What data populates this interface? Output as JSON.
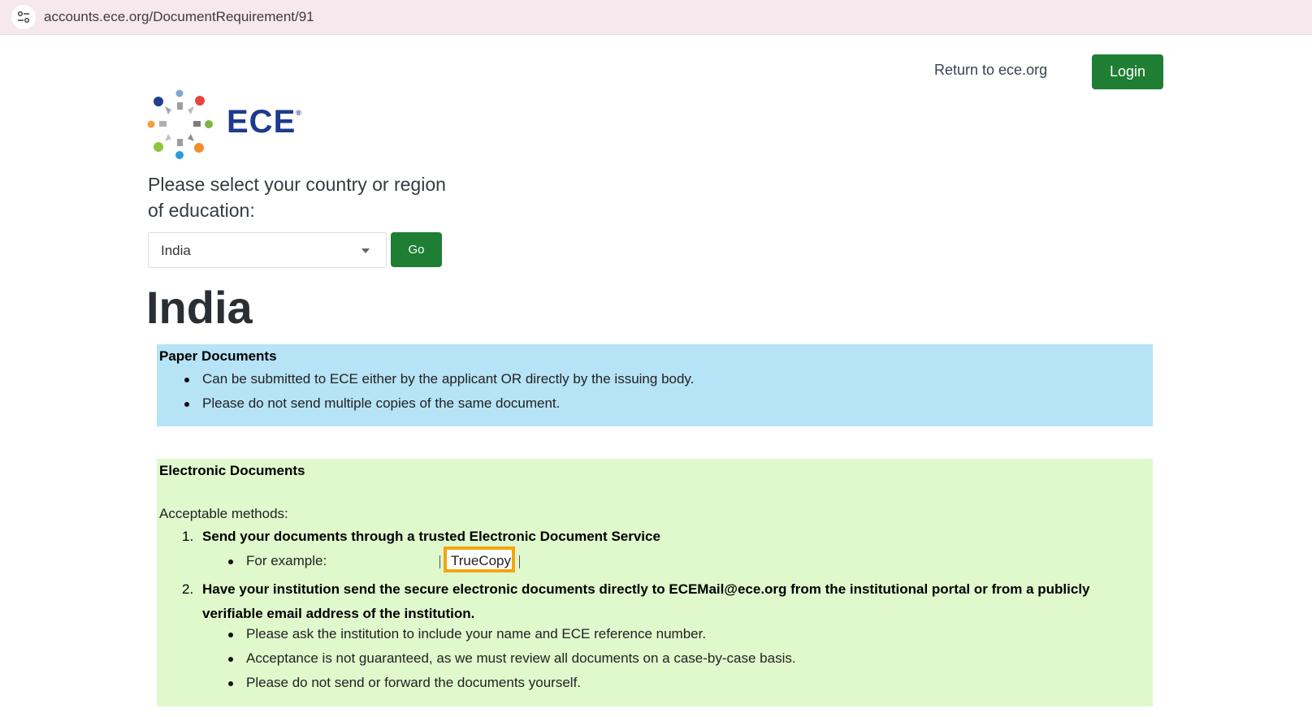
{
  "browser": {
    "url": "accounts.ece.org/DocumentRequirement/91",
    "site_icon": "tune-icon"
  },
  "header": {
    "return_link": "Return to ece.org",
    "login_label": "Login"
  },
  "logo": {
    "text": "ECE",
    "reg_mark": "®"
  },
  "selector": {
    "prompt": "Please select your country or region of education:",
    "selected": "India",
    "go_label": "Go"
  },
  "country_title": "India",
  "paper": {
    "heading": "Paper Documents",
    "bullets": [
      "Can be submitted to ECE either by the applicant OR directly by the issuing body.",
      "Please do not send multiple copies of the same document."
    ]
  },
  "electronic": {
    "heading": "Electronic Documents",
    "intro": "Acceptable methods:",
    "methods": [
      {
        "number": "1.",
        "title": "Send your documents through a trusted Electronic Document Service",
        "example_label": "For example:",
        "example_value": "TrueCopy"
      },
      {
        "number": "2.",
        "title": "Have your institution send the secure electronic documents directly to ECEMail@ece.org from the institutional portal or from a publicly verifiable email address of the institution.",
        "bullets": [
          "Please ask the institution to include your name and ECE reference number.",
          "Acceptance is not guaranteed, as we must review all documents on a case-by-case basis.",
          "Please do not send or forward the documents yourself."
        ]
      }
    ]
  },
  "colors": {
    "primary_green": "#1e7e34",
    "paper_bg": "#b6e3f6",
    "electronic_bg": "#dff8cc",
    "highlight": "#f4a60f",
    "logo_blue": "#1d3b8c"
  }
}
